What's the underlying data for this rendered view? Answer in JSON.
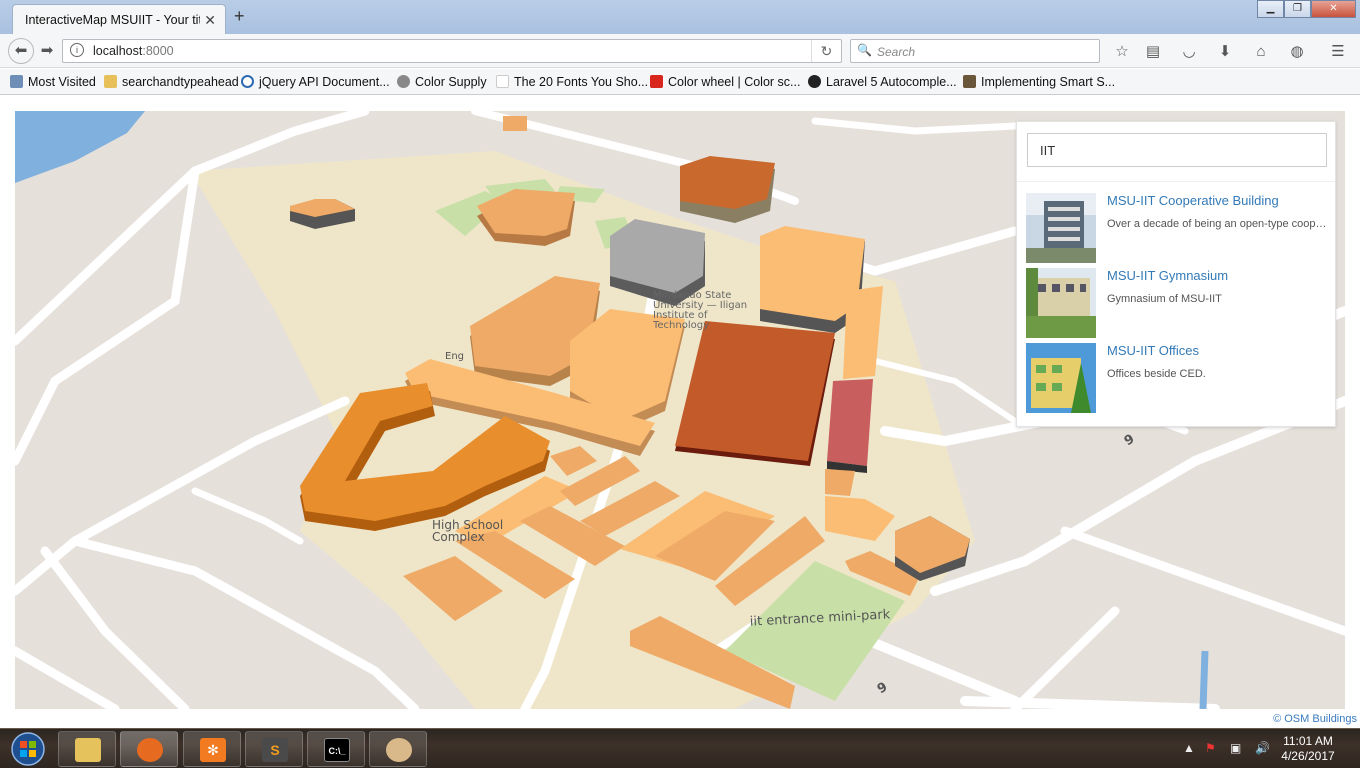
{
  "browser": {
    "tab_title": "InteractiveMap MSUIIT - Your title",
    "url_host": "localhost",
    "url_port": ":8000",
    "search_placeholder": "Search",
    "bookmarks": [
      {
        "label": "Most Visited",
        "icon": "star-folder-icon"
      },
      {
        "label": "searchandtypeahead",
        "icon": "folder-icon"
      },
      {
        "label": "jQuery API Document...",
        "icon": "jquery-icon"
      },
      {
        "label": "Color Supply",
        "icon": "globe-icon"
      },
      {
        "label": "The 20 Fonts You Sho...",
        "icon": "page-icon"
      },
      {
        "label": "Color wheel | Color sc...",
        "icon": "adobe-icon"
      },
      {
        "label": "Laravel 5 Autocomple...",
        "icon": "laravel-icon"
      },
      {
        "label": "Implementing Smart S...",
        "icon": "person-icon"
      }
    ]
  },
  "map": {
    "labels": {
      "university": "Mindanao State University — Iligan Institute of Technology",
      "engineering": "Eng",
      "high_school": "High School Complex",
      "park": "iit entrance mini-park",
      "road_number_1": "9",
      "road_number_2": "9"
    },
    "attribution": "© OSM Buildings"
  },
  "search_panel": {
    "query": "IIT",
    "results": [
      {
        "name": "MSU-IIT Cooperative Building",
        "description": "Over a decade of being an open-type cooperative"
      },
      {
        "name": "MSU-IIT Gymnasium",
        "description": "Gymnasium of MSU-IIT"
      },
      {
        "name": "MSU-IIT Offices",
        "description": "Offices beside CED."
      }
    ]
  },
  "taskbar": {
    "time": "11:01 AM",
    "date": "4/26/2017"
  }
}
